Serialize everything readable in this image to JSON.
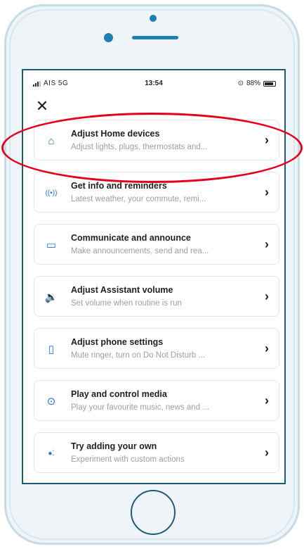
{
  "status_bar": {
    "carrier": "AIS 5G",
    "time": "13:54",
    "battery": "88%"
  },
  "close_label": "✕",
  "routines": [
    {
      "icon": "home-icon",
      "glyph": "⌂",
      "title": "Adjust Home devices",
      "subtitle": "Adjust lights, plugs, thermostats and..."
    },
    {
      "icon": "broadcast-icon",
      "glyph": "((•))",
      "title": "Get info and reminders",
      "subtitle": "Latest weather, your commute, remi..."
    },
    {
      "icon": "chat-icon",
      "glyph": "▭",
      "title": "Communicate and announce",
      "subtitle": "Make announcements, send and rea..."
    },
    {
      "icon": "volume-icon",
      "glyph": "🔉",
      "title": "Adjust Assistant volume",
      "subtitle": "Set volume when routine is run"
    },
    {
      "icon": "phone-icon",
      "glyph": "▯",
      "title": "Adjust phone settings",
      "subtitle": "Mute ringer, turn on Do Not Disturb ..."
    },
    {
      "icon": "play-icon",
      "glyph": "⊙",
      "title": "Play and control media",
      "subtitle": "Play your favourite music, news and ..."
    },
    {
      "icon": "assistant-icon",
      "glyph": "●⁚",
      "title": "Try adding your own",
      "subtitle": "Experiment with custom actions"
    }
  ],
  "chevron": "›",
  "colors": {
    "accent": "#1f6fd1",
    "highlight": "#e2001a",
    "frame": "#1f5a7a"
  }
}
